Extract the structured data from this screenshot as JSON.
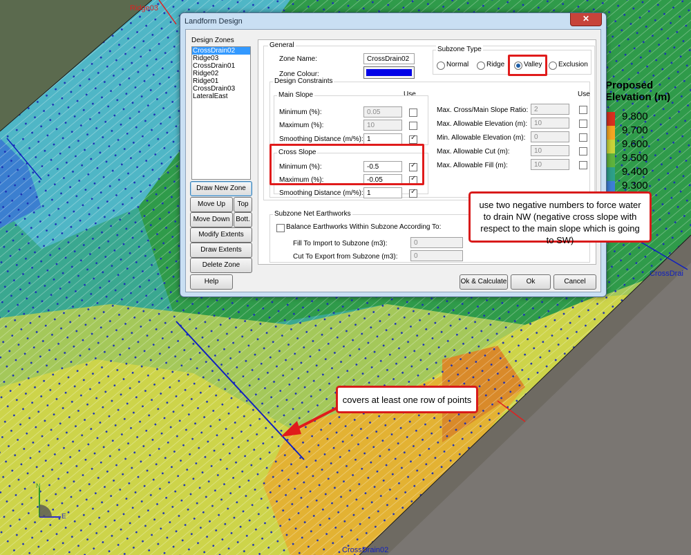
{
  "dialog": {
    "title": "Landform Design",
    "close_glyph": "✕",
    "zones_label": "Design Zones",
    "zones": [
      "CrossDrain02",
      "Ridge03",
      "CrossDrain01",
      "Ridge02",
      "Ridge01",
      "CrossDrain03",
      "LateralEast"
    ],
    "selected_zone_index": 0,
    "left_buttons": {
      "draw_new_zone": "Draw New Zone",
      "move_up": "Move Up",
      "top": "Top",
      "move_down": "Move Down",
      "bottom": "Bott.",
      "modify_extents": "Modify Extents",
      "draw_extents": "Draw Extents",
      "delete_zone": "Delete Zone"
    },
    "general": {
      "label": "General",
      "zone_name_label": "Zone Name:",
      "zone_name_value": "CrossDrain02",
      "zone_colour_label": "Zone Colour:",
      "zone_colour": "#0000e6"
    },
    "subzone_type": {
      "label": "Subzone Type",
      "options": [
        "Normal",
        "Ridge",
        "Valley",
        "Exclusion"
      ],
      "selected": "Valley"
    },
    "design_constraints": {
      "label": "Design Constraints",
      "use_label": "Use",
      "main_slope": {
        "label": "Main Slope",
        "minimum_label": "Minimum (%):",
        "minimum_value": "0.05",
        "minimum_use": false,
        "maximum_label": "Maximum (%):",
        "maximum_value": "10",
        "maximum_use": false,
        "smoothing_label": "Smoothing Distance (m/%):",
        "smoothing_value": "1",
        "smoothing_use": true
      },
      "cross_slope": {
        "label": "Cross Slope",
        "minimum_label": "Minimum (%):",
        "minimum_value": "-0.5",
        "minimum_use": true,
        "maximum_label": "Maximum (%):",
        "maximum_value": "-0.05",
        "maximum_use": true,
        "smoothing_label": "Smoothing Distance (m/%):",
        "smoothing_value": "1",
        "smoothing_use": true
      },
      "right": {
        "use_label": "Use",
        "ratio_label": "Max. Cross/Main Slope Ratio:",
        "ratio_value": "2",
        "max_elev_label": "Max. Allowable Elevation (m):",
        "max_elev_value": "10",
        "min_elev_label": "Min. Allowable Elevation (m):",
        "min_elev_value": "0",
        "max_cut_label": "Max. Allowable Cut (m):",
        "max_cut_value": "10",
        "max_fill_label": "Max. Allowable Fill (m):",
        "max_fill_value": "10"
      }
    },
    "earthworks": {
      "label": "Subzone Net Earthworks",
      "balance_label": "Balance Earthworks Within Subzone According To:",
      "balance_checked": false,
      "fill_label": "Fill To Import to Subzone (m3):",
      "fill_value": "0",
      "cut_label": "Cut To Export from Subzone (m3):",
      "cut_value": "0"
    },
    "bottom_buttons": {
      "help": "Help",
      "ok_calculate": "Ok & Calculate",
      "ok": "Ok",
      "cancel": "Cancel"
    }
  },
  "legend": {
    "title_line1": "Proposed",
    "title_line2": "Elevation (m)",
    "items": [
      {
        "label": "9.800",
        "color": "#d7301f"
      },
      {
        "label": "9.700",
        "color": "#f5a623"
      },
      {
        "label": "9.600",
        "color": "#c8d43a"
      },
      {
        "label": "9.500",
        "color": "#5fb33d"
      },
      {
        "label": "9.400",
        "color": "#2ea08a"
      },
      {
        "label": "9.300",
        "color": "#3d7fd6"
      }
    ]
  },
  "map_labels": {
    "ridge_top": "Ridge03",
    "crossdrain_right": "CrossDrai",
    "crossdrain_bottom": "CrossDrain02",
    "axis_n": "N",
    "axis_e": "E"
  },
  "annotations": {
    "callout_cross_slope": "use two negative numbers to force water to drain NW (negative cross slope with respect to the main slope which is going to SW)",
    "callout_points": "covers at least one row of points"
  },
  "colors": {
    "highlight_red": "#e01b1b",
    "selection_blue": "#3399ff"
  }
}
